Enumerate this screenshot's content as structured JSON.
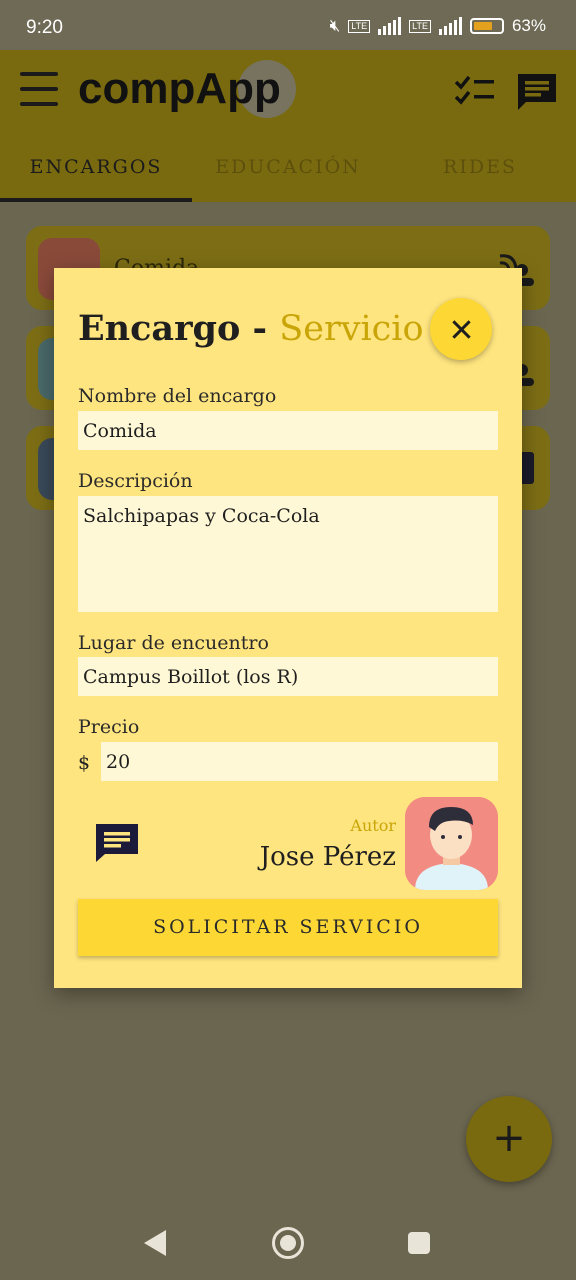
{
  "status_bar": {
    "time": "9:20",
    "battery": "63%"
  },
  "app": {
    "logo_text": "compApp"
  },
  "tabs": [
    {
      "label": "ENCARGOS",
      "active": true
    },
    {
      "label": "EDUCACIÓN",
      "active": false
    },
    {
      "label": "RIDES",
      "active": false
    }
  ],
  "background_cards": [
    {
      "label": "Comida"
    }
  ],
  "dialog": {
    "title_main": "Encargo - ",
    "title_accent": "Servicio",
    "fields": {
      "name_label": "Nombre del encargo",
      "name_value": "Comida",
      "desc_label": "Descripción",
      "desc_value": "Salchipapas y Coca-Cola",
      "place_label": "Lugar de encuentro",
      "place_value": "Campus Boillot (los R)",
      "price_label": "Precio",
      "price_prefix": "$",
      "price_value": "20"
    },
    "author": {
      "label": "Autor",
      "name": "Jose Pérez"
    },
    "action_button": "SOLICITAR SERVICIO"
  },
  "fab": {
    "symbol": "+"
  },
  "colors": {
    "accent": "#fdd835",
    "dialog_bg": "#ffe57f",
    "title_accent": "#c9a508",
    "icon_dark": "#1c1a3a"
  },
  "icons": [
    "menu-icon",
    "checklist-icon",
    "chat-icon",
    "close-icon",
    "add-icon",
    "back-icon",
    "home-icon",
    "recents-icon"
  ]
}
